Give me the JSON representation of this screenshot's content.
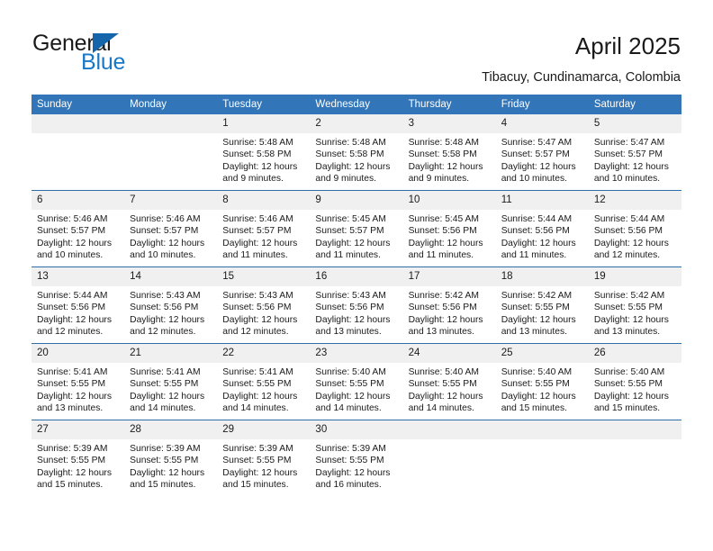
{
  "brand": {
    "name_part1": "General",
    "name_part2": "Blue",
    "flag_icon": "triangle-flag-icon",
    "accent_color": "#1878c8"
  },
  "header": {
    "title": "April 2025",
    "subtitle": "Tibacuy, Cundinamarca, Colombia"
  },
  "calendar": {
    "header_bg": "#3275b8",
    "row_divider_color": "#2d6da8",
    "daynum_bg": "#f0f0f0",
    "weekdays": [
      "Sunday",
      "Monday",
      "Tuesday",
      "Wednesday",
      "Thursday",
      "Friday",
      "Saturday"
    ],
    "weeks": [
      [
        {
          "day": "",
          "empty": true
        },
        {
          "day": "",
          "empty": true
        },
        {
          "day": "1",
          "sunrise": "Sunrise: 5:48 AM",
          "sunset": "Sunset: 5:58 PM",
          "daylight_line1": "Daylight: 12 hours",
          "daylight_line2": "and 9 minutes."
        },
        {
          "day": "2",
          "sunrise": "Sunrise: 5:48 AM",
          "sunset": "Sunset: 5:58 PM",
          "daylight_line1": "Daylight: 12 hours",
          "daylight_line2": "and 9 minutes."
        },
        {
          "day": "3",
          "sunrise": "Sunrise: 5:48 AM",
          "sunset": "Sunset: 5:58 PM",
          "daylight_line1": "Daylight: 12 hours",
          "daylight_line2": "and 9 minutes."
        },
        {
          "day": "4",
          "sunrise": "Sunrise: 5:47 AM",
          "sunset": "Sunset: 5:57 PM",
          "daylight_line1": "Daylight: 12 hours",
          "daylight_line2": "and 10 minutes."
        },
        {
          "day": "5",
          "sunrise": "Sunrise: 5:47 AM",
          "sunset": "Sunset: 5:57 PM",
          "daylight_line1": "Daylight: 12 hours",
          "daylight_line2": "and 10 minutes."
        }
      ],
      [
        {
          "day": "6",
          "sunrise": "Sunrise: 5:46 AM",
          "sunset": "Sunset: 5:57 PM",
          "daylight_line1": "Daylight: 12 hours",
          "daylight_line2": "and 10 minutes."
        },
        {
          "day": "7",
          "sunrise": "Sunrise: 5:46 AM",
          "sunset": "Sunset: 5:57 PM",
          "daylight_line1": "Daylight: 12 hours",
          "daylight_line2": "and 10 minutes."
        },
        {
          "day": "8",
          "sunrise": "Sunrise: 5:46 AM",
          "sunset": "Sunset: 5:57 PM",
          "daylight_line1": "Daylight: 12 hours",
          "daylight_line2": "and 11 minutes."
        },
        {
          "day": "9",
          "sunrise": "Sunrise: 5:45 AM",
          "sunset": "Sunset: 5:57 PM",
          "daylight_line1": "Daylight: 12 hours",
          "daylight_line2": "and 11 minutes."
        },
        {
          "day": "10",
          "sunrise": "Sunrise: 5:45 AM",
          "sunset": "Sunset: 5:56 PM",
          "daylight_line1": "Daylight: 12 hours",
          "daylight_line2": "and 11 minutes."
        },
        {
          "day": "11",
          "sunrise": "Sunrise: 5:44 AM",
          "sunset": "Sunset: 5:56 PM",
          "daylight_line1": "Daylight: 12 hours",
          "daylight_line2": "and 11 minutes."
        },
        {
          "day": "12",
          "sunrise": "Sunrise: 5:44 AM",
          "sunset": "Sunset: 5:56 PM",
          "daylight_line1": "Daylight: 12 hours",
          "daylight_line2": "and 12 minutes."
        }
      ],
      [
        {
          "day": "13",
          "sunrise": "Sunrise: 5:44 AM",
          "sunset": "Sunset: 5:56 PM",
          "daylight_line1": "Daylight: 12 hours",
          "daylight_line2": "and 12 minutes."
        },
        {
          "day": "14",
          "sunrise": "Sunrise: 5:43 AM",
          "sunset": "Sunset: 5:56 PM",
          "daylight_line1": "Daylight: 12 hours",
          "daylight_line2": "and 12 minutes."
        },
        {
          "day": "15",
          "sunrise": "Sunrise: 5:43 AM",
          "sunset": "Sunset: 5:56 PM",
          "daylight_line1": "Daylight: 12 hours",
          "daylight_line2": "and 12 minutes."
        },
        {
          "day": "16",
          "sunrise": "Sunrise: 5:43 AM",
          "sunset": "Sunset: 5:56 PM",
          "daylight_line1": "Daylight: 12 hours",
          "daylight_line2": "and 13 minutes."
        },
        {
          "day": "17",
          "sunrise": "Sunrise: 5:42 AM",
          "sunset": "Sunset: 5:56 PM",
          "daylight_line1": "Daylight: 12 hours",
          "daylight_line2": "and 13 minutes."
        },
        {
          "day": "18",
          "sunrise": "Sunrise: 5:42 AM",
          "sunset": "Sunset: 5:55 PM",
          "daylight_line1": "Daylight: 12 hours",
          "daylight_line2": "and 13 minutes."
        },
        {
          "day": "19",
          "sunrise": "Sunrise: 5:42 AM",
          "sunset": "Sunset: 5:55 PM",
          "daylight_line1": "Daylight: 12 hours",
          "daylight_line2": "and 13 minutes."
        }
      ],
      [
        {
          "day": "20",
          "sunrise": "Sunrise: 5:41 AM",
          "sunset": "Sunset: 5:55 PM",
          "daylight_line1": "Daylight: 12 hours",
          "daylight_line2": "and 13 minutes."
        },
        {
          "day": "21",
          "sunrise": "Sunrise: 5:41 AM",
          "sunset": "Sunset: 5:55 PM",
          "daylight_line1": "Daylight: 12 hours",
          "daylight_line2": "and 14 minutes."
        },
        {
          "day": "22",
          "sunrise": "Sunrise: 5:41 AM",
          "sunset": "Sunset: 5:55 PM",
          "daylight_line1": "Daylight: 12 hours",
          "daylight_line2": "and 14 minutes."
        },
        {
          "day": "23",
          "sunrise": "Sunrise: 5:40 AM",
          "sunset": "Sunset: 5:55 PM",
          "daylight_line1": "Daylight: 12 hours",
          "daylight_line2": "and 14 minutes."
        },
        {
          "day": "24",
          "sunrise": "Sunrise: 5:40 AM",
          "sunset": "Sunset: 5:55 PM",
          "daylight_line1": "Daylight: 12 hours",
          "daylight_line2": "and 14 minutes."
        },
        {
          "day": "25",
          "sunrise": "Sunrise: 5:40 AM",
          "sunset": "Sunset: 5:55 PM",
          "daylight_line1": "Daylight: 12 hours",
          "daylight_line2": "and 15 minutes."
        },
        {
          "day": "26",
          "sunrise": "Sunrise: 5:40 AM",
          "sunset": "Sunset: 5:55 PM",
          "daylight_line1": "Daylight: 12 hours",
          "daylight_line2": "and 15 minutes."
        }
      ],
      [
        {
          "day": "27",
          "sunrise": "Sunrise: 5:39 AM",
          "sunset": "Sunset: 5:55 PM",
          "daylight_line1": "Daylight: 12 hours",
          "daylight_line2": "and 15 minutes."
        },
        {
          "day": "28",
          "sunrise": "Sunrise: 5:39 AM",
          "sunset": "Sunset: 5:55 PM",
          "daylight_line1": "Daylight: 12 hours",
          "daylight_line2": "and 15 minutes."
        },
        {
          "day": "29",
          "sunrise": "Sunrise: 5:39 AM",
          "sunset": "Sunset: 5:55 PM",
          "daylight_line1": "Daylight: 12 hours",
          "daylight_line2": "and 15 minutes."
        },
        {
          "day": "30",
          "sunrise": "Sunrise: 5:39 AM",
          "sunset": "Sunset: 5:55 PM",
          "daylight_line1": "Daylight: 12 hours",
          "daylight_line2": "and 16 minutes."
        },
        {
          "day": "",
          "empty": true
        },
        {
          "day": "",
          "empty": true
        },
        {
          "day": "",
          "empty": true
        }
      ]
    ]
  }
}
